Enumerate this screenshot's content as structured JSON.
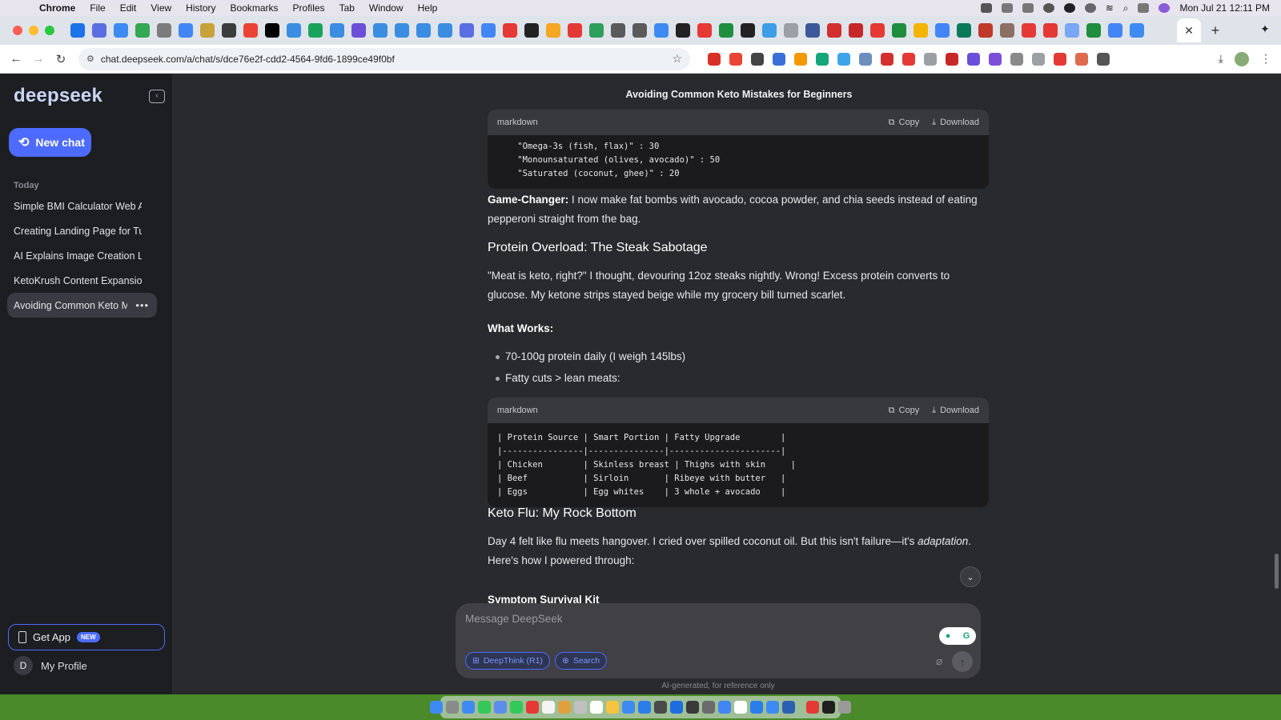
{
  "menubar": {
    "app": "Chrome",
    "items": [
      "File",
      "Edit",
      "View",
      "History",
      "Bookmarks",
      "Profiles",
      "Tab",
      "Window",
      "Help"
    ],
    "clock": "Mon Jul 21  12:11 PM"
  },
  "browser": {
    "url": "chat.deepseek.com/a/chat/s/dce76e2f-cdd2-4564-9fd6-1899ce49f0bf",
    "active_tab_close": "✕",
    "new_tab": "+",
    "tab_icon_colors": [
      "#1a73e8",
      "#5b6ee1",
      "#3d8bf2",
      "#34a853",
      "#7c7c7c",
      "#4285f4",
      "#c7a23a",
      "#3c3c3c",
      "#ea4335",
      "#000000",
      "#3a8de0",
      "#19a35a",
      "#3a8de0",
      "#6b4fd8",
      "#3a8de0",
      "#3a8de0",
      "#3a8de0",
      "#3a8de0",
      "#5b6ee1",
      "#4285f4",
      "#e53935",
      "#222222",
      "#f5a623",
      "#e53935",
      "#2e9e5b",
      "#5a5a5a",
      "#5a5a5a",
      "#3d8bf2",
      "#222222",
      "#e53935",
      "#1e8e3e",
      "#222222",
      "#3c9ee5",
      "#9aa0a6",
      "#3b5998",
      "#d32f2f",
      "#c62828",
      "#e53935",
      "#1e8e3e",
      "#f4b400",
      "#4285f4",
      "#0b7a5b",
      "#c0392b",
      "#8d6e63",
      "#e53935",
      "#e53935",
      "#7aa7f5",
      "#1e8e3e",
      "#4285f4",
      "#3d8bf2"
    ],
    "extension_colors": [
      "#d93025",
      "#ea4335",
      "#444444",
      "#3a6fd8",
      "#f29900",
      "#15a77a",
      "#3ca5ea",
      "#6c8ebf",
      "#d32f2f",
      "#e53935",
      "#9aa0a6",
      "#c62828",
      "#6b4fd8",
      "#7b4fd8",
      "#8a8a8a",
      "#9aa0a6",
      "#e53935",
      "#e06a4e",
      "#555555"
    ]
  },
  "sidebar": {
    "logo": "deepseek",
    "new_chat_label": "New chat",
    "section_label": "Today",
    "chats": [
      {
        "label": "Simple BMI Calculator Web Ap"
      },
      {
        "label": "Creating Landing Page for Tub"
      },
      {
        "label": "AI Explains Image Creation Lim"
      },
      {
        "label": "KetoKrush Content Expansion"
      },
      {
        "label": "Avoiding Common Keto M"
      }
    ],
    "active_chat_more": "•••",
    "get_app_label": "Get App",
    "get_app_badge": "NEW",
    "profile_initial": "D",
    "profile_label": "My Profile"
  },
  "main": {
    "title": "Avoiding Common Keto Mistakes for Beginners",
    "code_blocks": [
      {
        "lang": "markdown",
        "copy": "Copy",
        "download": "Download",
        "lines": [
          "    \"Omega-3s (fish, flax)\" : 30",
          "    \"Monounsaturated (olives, avocado)\" : 50",
          "    \"Saturated (coconut, ghee)\" : 20"
        ]
      },
      {
        "lang": "markdown",
        "copy": "Copy",
        "download": "Download",
        "lines": [
          "| Protein Source | Smart Portion | Fatty Upgrade        |",
          "|----------------|---------------|----------------------|",
          "| Chicken        | Skinless breast | Thighs with skin     |",
          "| Beef           | Sirloin       | Ribeye with butter   |",
          "| Eggs           | Egg whites    | 3 whole + avocado    |"
        ]
      }
    ],
    "game_changer_label": "Game-Changer:",
    "game_changer_text": " I now make fat bombs with avocado, cocoa powder, and chia seeds instead of eating pepperoni straight from the bag.",
    "protein_heading": "Protein Overload: The Steak Sabotage",
    "protein_text": "\"Meat is keto, right?\" I thought, devouring 12oz steaks nightly. Wrong! Excess protein converts to glucose. My ketone strips stayed beige while my grocery bill turned scarlet.",
    "what_works_label": "What Works:",
    "bullets": [
      "70-100g protein daily (I weigh 145lbs)",
      "Fatty cuts > lean meats:"
    ],
    "keto_flu_heading": "Keto Flu: My Rock Bottom",
    "keto_flu_text_1": "Day 4 felt like flu meets hangover. I cried over spilled coconut oil. But this isn't failure—it's ",
    "keto_flu_italic": "adaptation",
    "keto_flu_text_2": ". Here's how I powered through:",
    "symptom_label": "Symptom Survival Kit"
  },
  "composer": {
    "placeholder": "Message DeepSeek",
    "deepthink_label": "DeepThink (R1)",
    "search_label": "Search",
    "disclaimer": "AI-generated, for reference only"
  },
  "dock": {
    "icon_colors": [
      "#3d8bf2",
      "#8a8a8a",
      "#3d8bf2",
      "#34c759",
      "#5b8def",
      "#34c759",
      "#e53935",
      "#f4f4f4",
      "#e0a040",
      "#c0c0c0",
      "#ffffff",
      "#f5c542",
      "#3d8bf2",
      "#2b7de9",
      "#4a4a4a",
      "#1e6de0",
      "#3a3a3a",
      "#6b6b6b",
      "#4285f4",
      "#ffffff",
      "#2b7de9",
      "#3d8bf2",
      "#2b5fb4",
      "#e53935",
      "#1e1e1e",
      "#9a9a9a"
    ]
  }
}
